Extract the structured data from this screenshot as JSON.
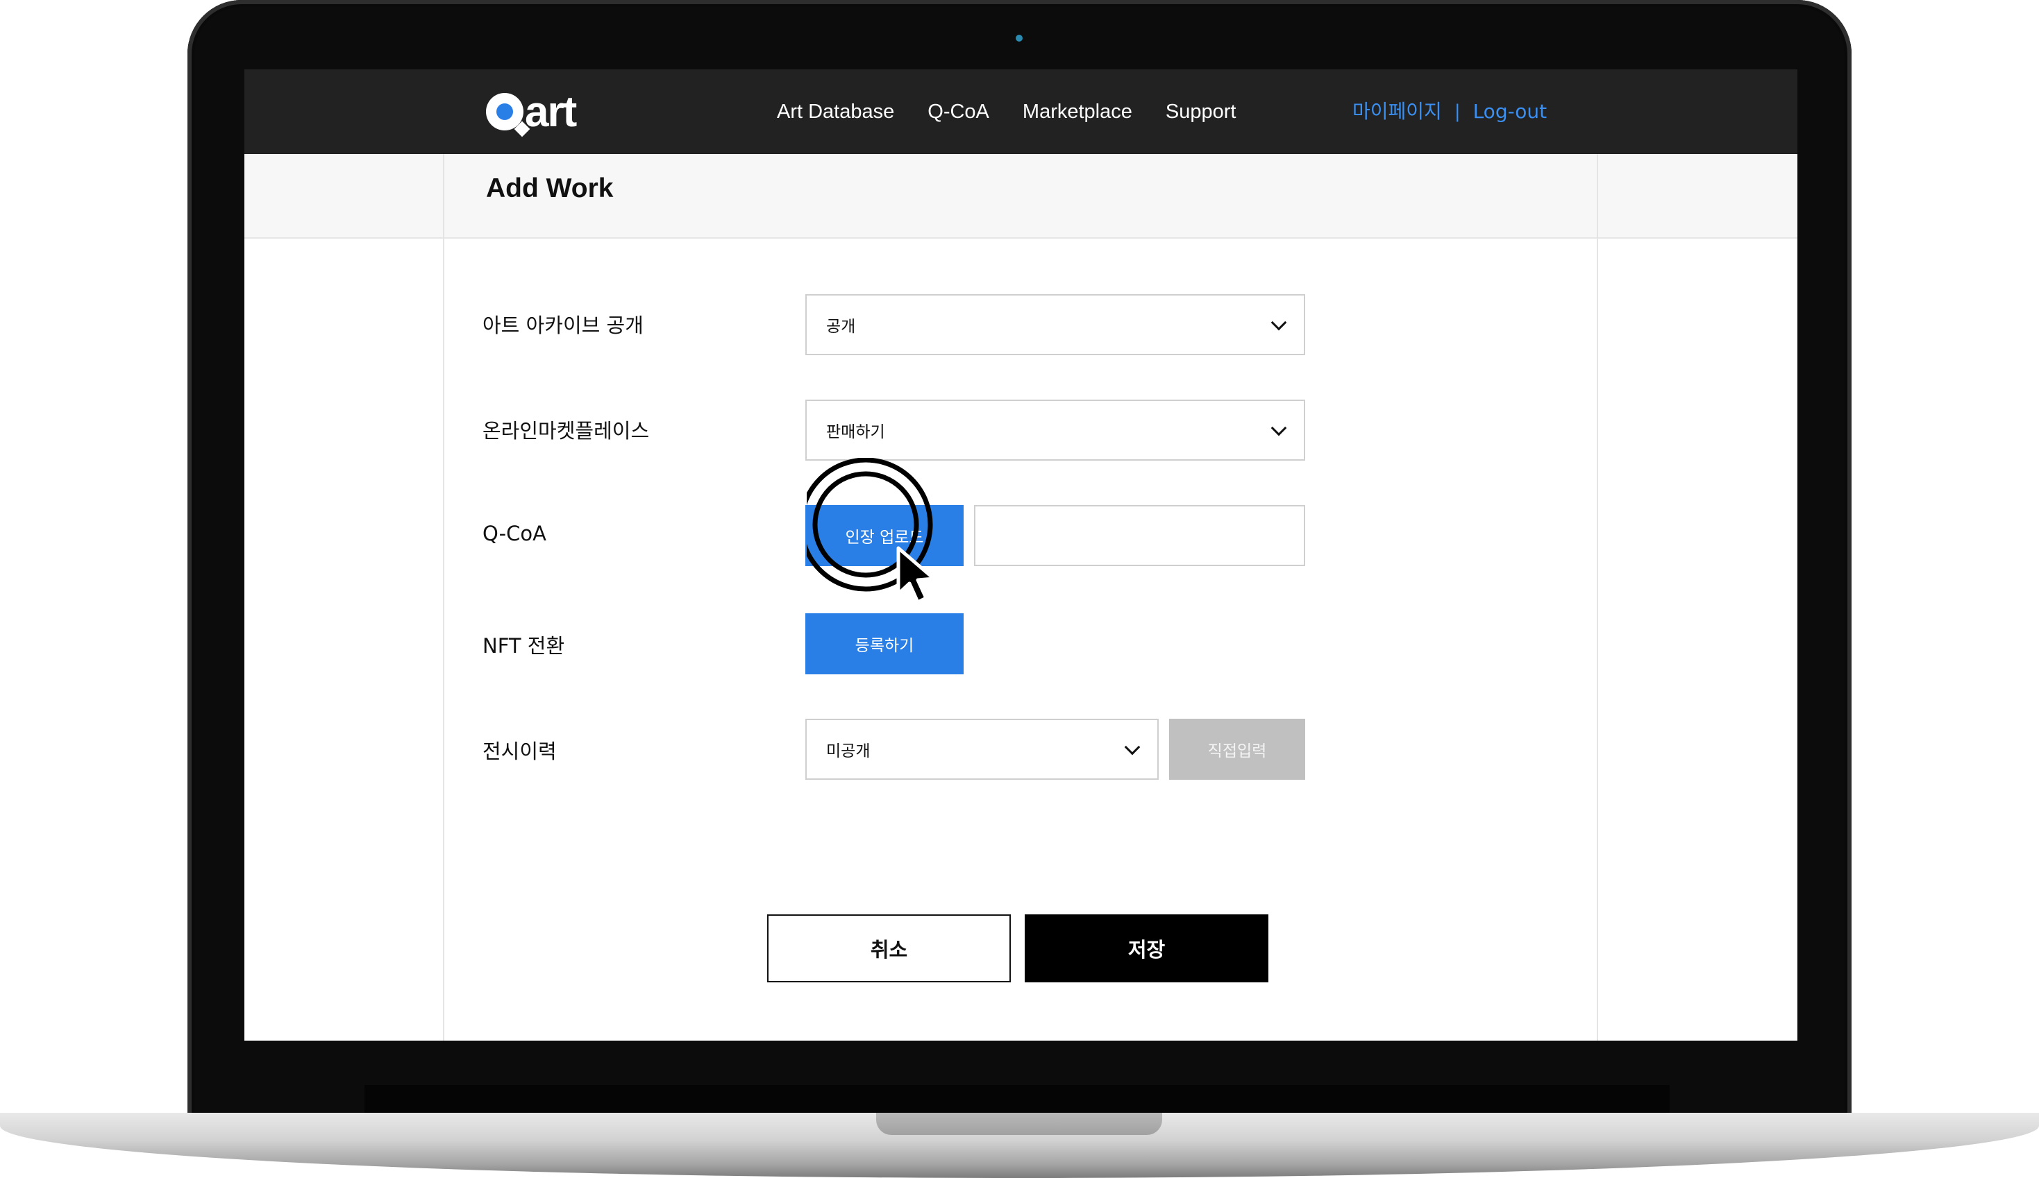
{
  "header": {
    "logo_text": "art",
    "nav": [
      "Art Database",
      "Q-CoA",
      "Marketplace",
      "Support"
    ],
    "mypage": "마이페이지",
    "separator": "|",
    "logout": "Log-out"
  },
  "page": {
    "title": "Add Work"
  },
  "form": {
    "archive": {
      "label": "아트 아카이브 공개",
      "value": "공개"
    },
    "marketplace": {
      "label": "온라인마켓플레이스",
      "value": "판매하기"
    },
    "qcoa": {
      "label": "Q-CoA",
      "button": "인장 업로드",
      "value": ""
    },
    "nft": {
      "label": "NFT 전환",
      "button": "등록하기"
    },
    "exhibition": {
      "label": "전시이력",
      "value": "미공개",
      "button": "직접입력"
    }
  },
  "actions": {
    "cancel": "취소",
    "save": "저장"
  },
  "colors": {
    "accent": "#2a7fe6",
    "header_bg": "#222222",
    "link": "#3a8ff0"
  }
}
